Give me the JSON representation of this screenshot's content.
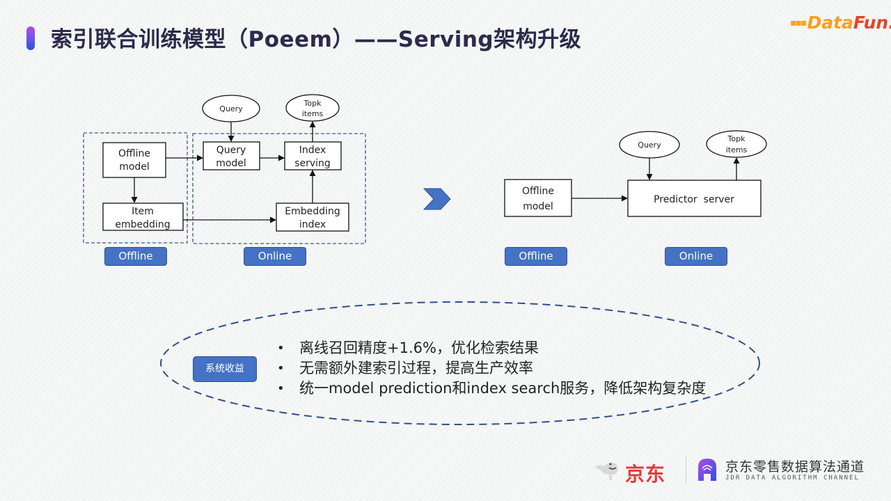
{
  "header": {
    "title": "索引联合训练模型（Poeem）——Serving架构升级",
    "logo_part1": "Data",
    "logo_part2": "Fun."
  },
  "colors": {
    "accent_blue": "#4472c4",
    "title_text": "#2b2b4b",
    "logo_orange": "#f5a020",
    "logo_red": "#e8432b",
    "jd_red": "#e4393c"
  },
  "old_architecture": {
    "nodes": {
      "query": "Query",
      "topk_line1": "Topk",
      "topk_line2": "items",
      "offline_model_line1": "Offline",
      "offline_model_line2": "model",
      "item_embedding_line1": "Item",
      "item_embedding_line2": "embedding",
      "query_model_line1": "Query",
      "query_model_line2": "model",
      "index_serving_line1": "Index",
      "index_serving_line2": "serving",
      "embedding_index_line1": "Embedding",
      "embedding_index_line2": "index"
    },
    "tags": {
      "offline": "Offline",
      "online": "Online"
    }
  },
  "transition_icon": "chevron-right-icon",
  "new_architecture": {
    "nodes": {
      "query": "Query",
      "topk_line1": "Topk",
      "topk_line2": "items",
      "offline_model_line1": "Offline",
      "offline_model_line2": "model",
      "predictor_server": "Predictor  server"
    },
    "tags": {
      "offline": "Offline",
      "online": "Online"
    }
  },
  "benefits": {
    "label": "系统收益",
    "items": [
      "离线召回精度+1.6%，优化检索结果",
      "无需额外建索引过程，提高生产效率",
      "统一model prediction和index search服务，降低架构复杂度"
    ]
  },
  "footer": {
    "jd_brand": "京东",
    "channel_cn": "京东零售数据算法通道",
    "channel_en": "JDR DATA ALGORITHM CHANNEL"
  }
}
